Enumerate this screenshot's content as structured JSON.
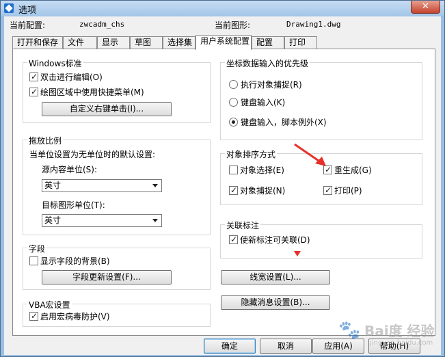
{
  "window": {
    "title": "选项",
    "close_glyph": "✕"
  },
  "header": {
    "profile_label": "当前配置:",
    "profile_value": "zwcadm_chs",
    "drawing_label": "当前图形:",
    "drawing_value": "Drawing1.dwg"
  },
  "tabs": [
    {
      "label": "打开和保存"
    },
    {
      "label": "文件"
    },
    {
      "label": "显示"
    },
    {
      "label": "草图"
    },
    {
      "label": "选择集"
    },
    {
      "label": "用户系统配置",
      "active": true
    },
    {
      "label": "配置"
    },
    {
      "label": "打印"
    }
  ],
  "windows_std": {
    "title": "Windows标准",
    "dblclick_edit": {
      "label": "双击进行编辑(O)",
      "checked": true
    },
    "shortcut_menu": {
      "label": "绘图区域中使用快捷菜单(M)",
      "checked": true
    },
    "right_click_btn": "自定义右键单击(I)..."
  },
  "insert_scale": {
    "title": "拖放比例",
    "desc": "当单位设置为无单位时的默认设置:",
    "source_label": "源内容单位(S):",
    "source_value": "英寸",
    "target_label": "目标图形单位(T):",
    "target_value": "英寸"
  },
  "fields": {
    "title": "字段",
    "show_bg": {
      "label": "显示字段的背景(B)",
      "checked": false
    },
    "update_btn": "字段更新设置(F)..."
  },
  "vba": {
    "title": "VBA宏设置",
    "virus_protect": {
      "label": "启用宏病毒防护(V)",
      "checked": true
    }
  },
  "coord_priority": {
    "title": "坐标数据输入的优先级",
    "options": [
      {
        "label": "执行对象捕捉(R)",
        "selected": false
      },
      {
        "label": "键盘输入(K)",
        "selected": false
      },
      {
        "label": "键盘输入，脚本例外(X)",
        "selected": true
      }
    ]
  },
  "sort_method": {
    "title": "对象排序方式",
    "obj_select": {
      "label": "对象选择(E)",
      "checked": false
    },
    "regen": {
      "label": "重生成(G)",
      "checked": true
    },
    "obj_snap": {
      "label": "对象捕捉(N)",
      "checked": true
    },
    "plot": {
      "label": "打印(P)",
      "checked": true
    }
  },
  "assoc_dim": {
    "title": "关联标注",
    "make_assoc": {
      "label": "使新标注可关联(D)",
      "checked": true
    }
  },
  "side_buttons": {
    "lineweight": "线宽设置(L)...",
    "hidden_msg": "隐藏消息设置(B)..."
  },
  "footer": {
    "ok": "确定",
    "cancel": "取消",
    "apply": "应用(A)",
    "help": "帮助(H)"
  },
  "watermark": {
    "text": "Bai度 经验",
    "sub": "jingyan.baidu.com"
  },
  "colors": {
    "annotation_red": "#e8302a",
    "title_bar": "#a4c6e8"
  }
}
